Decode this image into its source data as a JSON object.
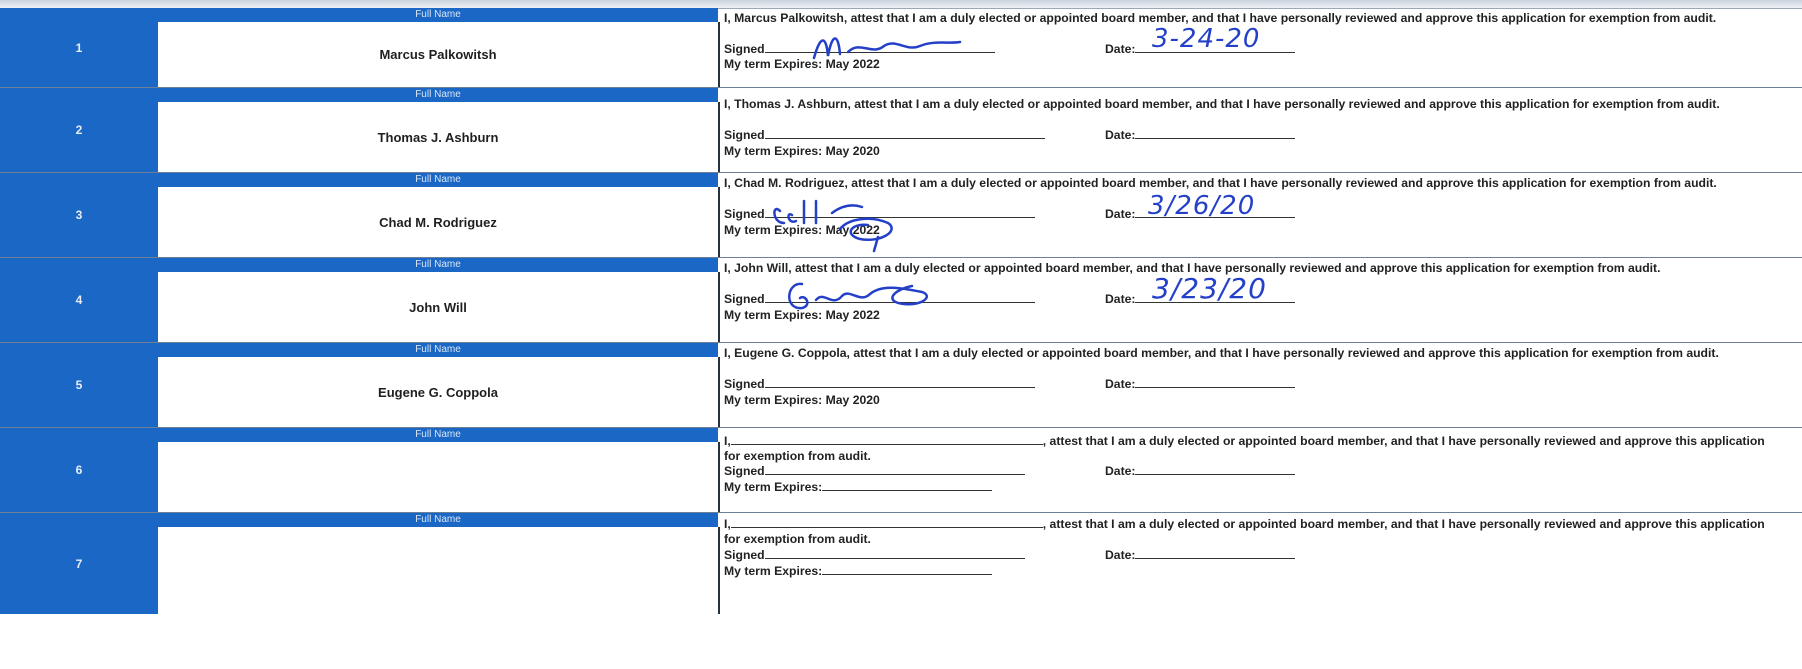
{
  "header_label": "Full Name",
  "signed_label": "Signed",
  "date_label": "Date:",
  "term_label": "My term Expires:",
  "members": [
    {
      "number": "1",
      "name": "Marcus Palkowitsh",
      "attest": "I, Marcus Palkowitsh, attest that I am a duly elected or appointed board member, and that I have personally reviewed and approve this application for exemption from audit.",
      "term": "My term Expires: May 2022",
      "date": "3-24-20"
    },
    {
      "number": "2",
      "name": "Thomas J. Ashburn",
      "attest": "I, Thomas J. Ashburn, attest that I am a duly elected or appointed board member, and that I have personally reviewed and approve this application for exemption from audit.",
      "term": "My term Expires: May 2020",
      "date": ""
    },
    {
      "number": "3",
      "name": "Chad M. Rodriguez",
      "attest": "I, Chad M. Rodriguez, attest that I am a duly elected or appointed board member, and that I have personally reviewed and approve this application for exemption from audit.",
      "term": "My term Expires: May 2022",
      "date": "3/26/20"
    },
    {
      "number": "4",
      "name": "John Will",
      "attest": "I, John Will, attest that I am a duly elected or appointed board member, and that I have personally reviewed and approve this application for exemption from audit.",
      "term": "My term Expires: May  2022",
      "date": "3/23/20"
    },
    {
      "number": "5",
      "name": "Eugene G. Coppola",
      "attest": "I, Eugene G. Coppola, attest that I am a duly elected or appointed board member, and that I have personally reviewed and approve this application for exemption from audit.",
      "term": "My term Expires: May 2020",
      "date": ""
    },
    {
      "number": "6",
      "name": "",
      "attest_prefix": "I,",
      "attest_suffix": ", attest that I am a duly elected or appointed board member, and that I have personally reviewed and approve this application for exemption from audit.",
      "term": "My term Expires:",
      "date": ""
    },
    {
      "number": "7",
      "name": "",
      "attest_prefix": "I,",
      "attest_suffix": ", attest that I am a duly elected or appointed board member, and that I have personally reviewed and approve this application for exemption from audit.",
      "term": "My term Expires:",
      "date": ""
    }
  ]
}
